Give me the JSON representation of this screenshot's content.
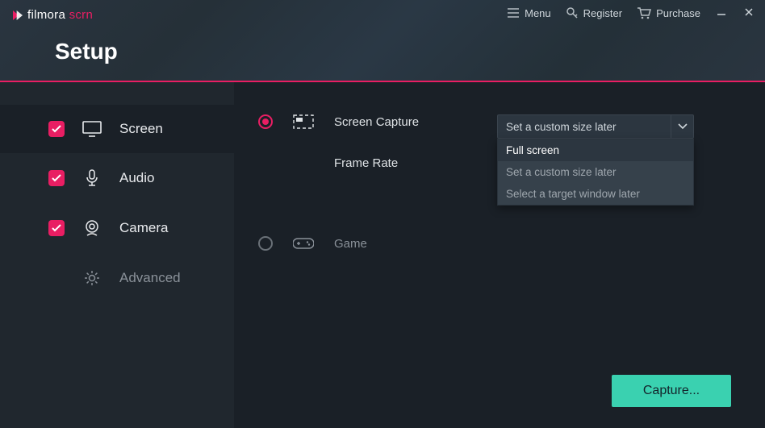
{
  "brand": {
    "name_a": "filmora",
    "name_b": " scrn"
  },
  "topmenu": {
    "menu": "Menu",
    "register": "Register",
    "purchase": "Purchase"
  },
  "page_title": "Setup",
  "sidebar": {
    "items": [
      {
        "label": "Screen",
        "checked": true,
        "active": true
      },
      {
        "label": "Audio",
        "checked": true,
        "active": false
      },
      {
        "label": "Camera",
        "checked": true,
        "active": false
      },
      {
        "label": "Advanced",
        "checked": false,
        "active": false
      }
    ]
  },
  "content": {
    "screen_capture": {
      "label": "Screen Capture",
      "selected": true
    },
    "frame_rate": {
      "label": "Frame Rate"
    },
    "game": {
      "label": "Game",
      "selected": false
    }
  },
  "capture_select": {
    "value": "Set a custom size later",
    "options": [
      "Full screen",
      "Set a custom size later",
      "Select a target window later"
    ],
    "highlight_index": 0
  },
  "capture_button": "Capture...",
  "colors": {
    "accent": "#e91e63",
    "cta": "#3ad1b0"
  }
}
